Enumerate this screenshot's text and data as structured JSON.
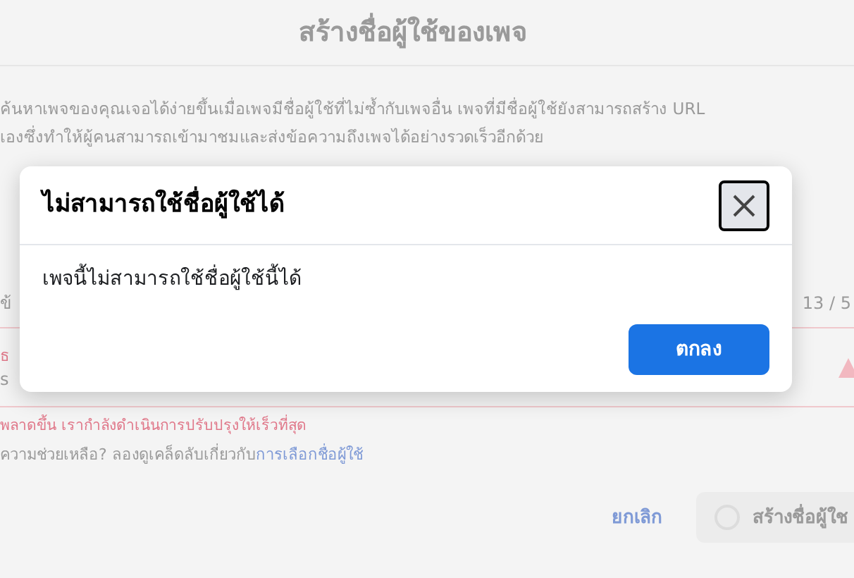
{
  "background": {
    "title": "สร้างชื่อผู้ใช้ของเพจ",
    "description": [
      "ค้นหาเพจของคุณเจอได้ง่ายขึ้นเมื่อเพจมีชื่อผู้ใช้ที่ไม่ซ้ำกับเพจอื่น เพจที่มีชื่อผู้ใช้ยังสามารถสร้าง URL",
      "เองซึ่งทำให้ผู้คนสามารถเข้ามาชมและส่งข้อความถึงเพจได้อย่างรวดเร็วอีกด้วย"
    ],
    "field_label": "ข้",
    "counter": "13 / 5",
    "error_label": "ธ",
    "field_value": "s",
    "error": "พลาดขึ้น เรากำลังดำเนินการปรับปรุงให้เร็วที่สุด",
    "help": "ความช่วยเหลือ? ลองดูเคล็ดลับเกี่ยวกับ",
    "help_link": "การเลือกชื่อผู้ใช้",
    "cancel": "ยกเลิก",
    "create": "สร้างชื่อผู้ใช"
  },
  "dialog": {
    "title": "ไม่สามารถใช้ชื่อผู้ใช้ได้",
    "message": "เพจนี้ไม่สามารถใช้ชื่อผู้ใช้นี้ได้",
    "ok": "ตกลง"
  }
}
